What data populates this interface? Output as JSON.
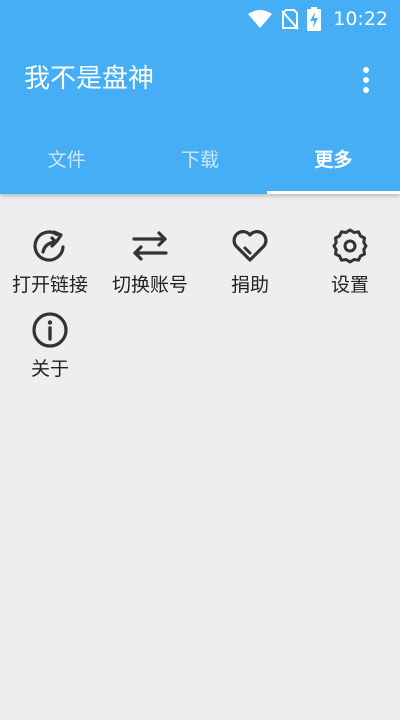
{
  "status_bar": {
    "time": "10:22",
    "icons": [
      "wifi-icon",
      "no-sim-icon",
      "battery-charging-icon"
    ]
  },
  "app": {
    "title": "我不是盘神",
    "menu_icon": "more-vert-icon"
  },
  "tabs": [
    {
      "label": "文件",
      "active": false
    },
    {
      "label": "下载",
      "active": false
    },
    {
      "label": "更多",
      "active": true
    }
  ],
  "more_items": [
    {
      "label": "打开链接",
      "icon": "open-link-icon"
    },
    {
      "label": "切换账号",
      "icon": "switch-account-icon"
    },
    {
      "label": "捐助",
      "icon": "heart-icon"
    },
    {
      "label": "设置",
      "icon": "gear-icon"
    },
    {
      "label": "关于",
      "icon": "info-icon"
    }
  ],
  "colors": {
    "primary": "#45aef5",
    "background": "#eeeeee",
    "icon": "#333333",
    "text": "#222222"
  }
}
